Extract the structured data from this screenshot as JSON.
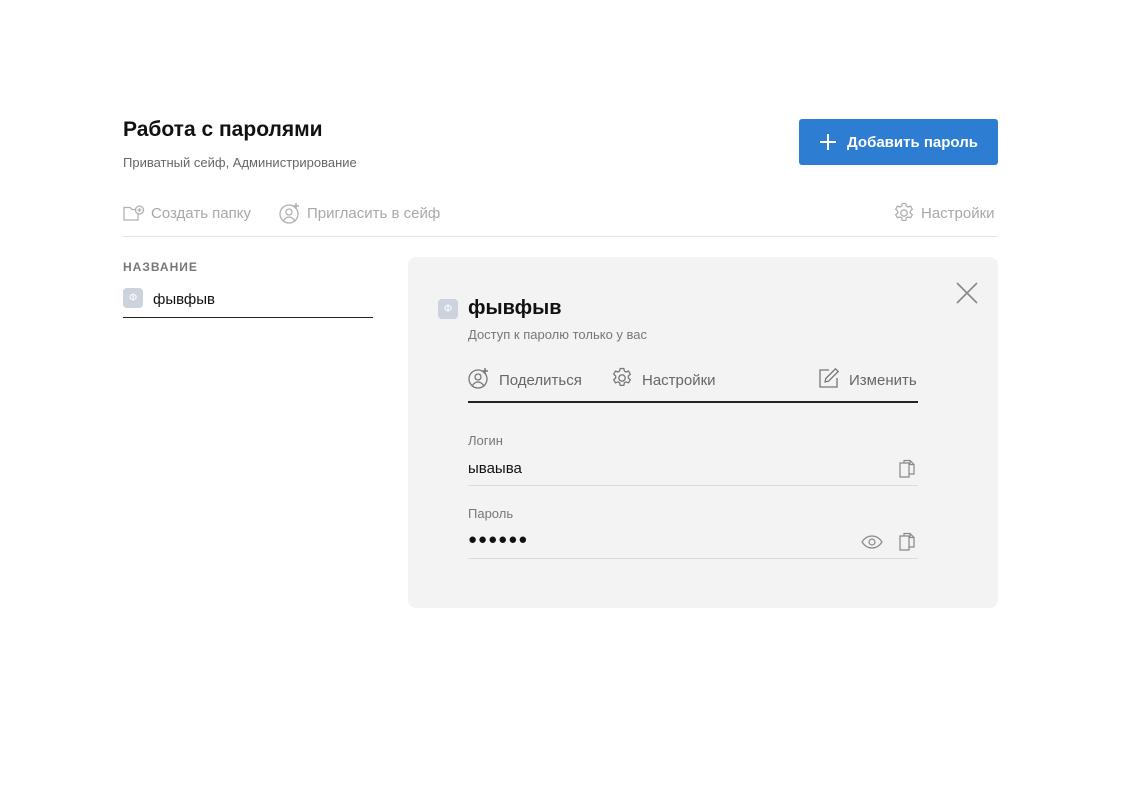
{
  "header": {
    "title": "Работа с паролями",
    "subtitle": "Приватный сейф, Администрирование",
    "add_button_label": "Добавить пароль",
    "add_button_icon": "plus-icon"
  },
  "toolbar": {
    "create_folder": {
      "label": "Создать папку",
      "icon": "folder-add-icon"
    },
    "invite": {
      "label": "Пригласить в сейф",
      "icon": "user-add-icon"
    },
    "settings": {
      "label": "Настройки",
      "icon": "gear-icon"
    }
  },
  "list": {
    "column_header": "НАЗВАНИЕ",
    "items": [
      {
        "avatar": "Ф",
        "name": "фывфыв"
      }
    ]
  },
  "detail": {
    "avatar": "Ф",
    "title": "фывфыв",
    "subtitle": "Доступ к паролю только у вас",
    "actions": {
      "share": {
        "label": "Поделиться",
        "icon": "user-add-icon"
      },
      "settings": {
        "label": "Настройки",
        "icon": "gear-icon"
      },
      "edit": {
        "label": "Изменить",
        "icon": "edit-icon"
      }
    },
    "fields": {
      "login": {
        "label": "Логин",
        "value": "ываыва",
        "copy_icon": "copy-icon"
      },
      "password": {
        "label": "Пароль",
        "value": "●●●●●●",
        "show_icon": "eye-icon",
        "copy_icon": "copy-icon"
      }
    },
    "close_icon": "close-icon"
  },
  "colors": {
    "accent": "#2d7dd2",
    "panel_bg": "#f3f3f3",
    "muted_text": "#a8a8a8"
  }
}
